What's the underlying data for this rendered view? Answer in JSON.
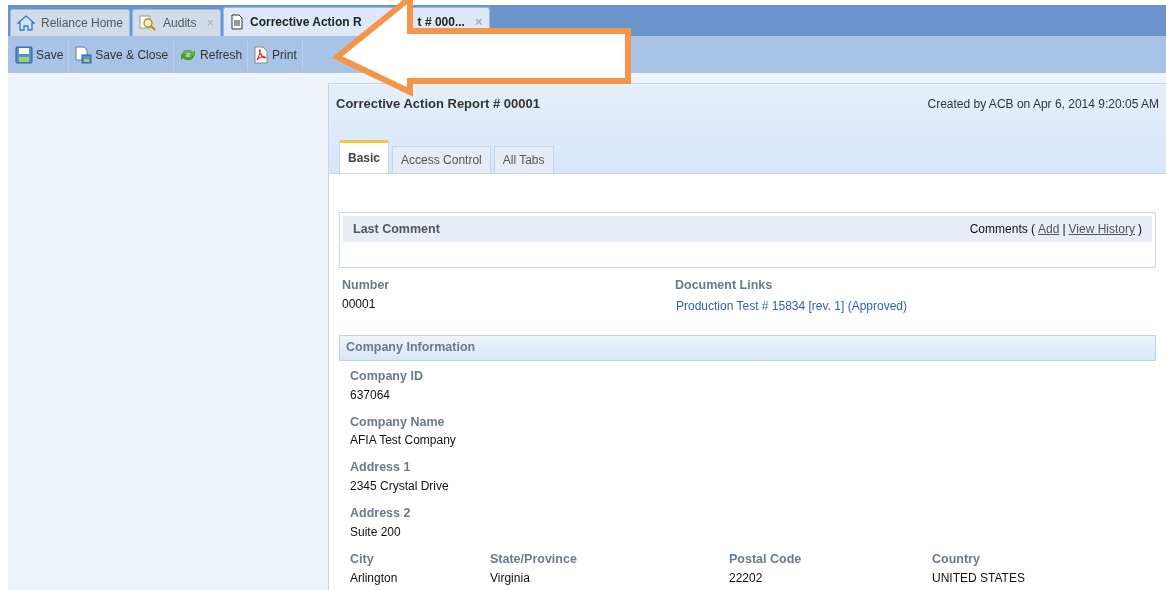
{
  "tabs": [
    {
      "label": "Reliance Home",
      "selected": false
    },
    {
      "label": "Audits",
      "close": "×",
      "selected": false
    },
    {
      "label": "Corrective Action R",
      "label_continued": "t # 000...",
      "close": "×",
      "selected": true
    }
  ],
  "toolbar": [
    {
      "label": "Save"
    },
    {
      "label": "Save & Close"
    },
    {
      "label": "Refresh"
    },
    {
      "label": "Print"
    }
  ],
  "report": {
    "title": "Corrective Action Report # 00001",
    "created": "Created by ACB on Apr 6, 2014 9:20:05 AM",
    "tabs": [
      {
        "label": "Basic",
        "selected": true
      },
      {
        "label": "Access Control",
        "selected": false
      },
      {
        "label": "All Tabs",
        "selected": false
      }
    ],
    "last_comment": {
      "title": "Last Comment",
      "comments_label": "Comments (",
      "add": "Add",
      "separator": "|",
      "view_history": "View History",
      "close": ")"
    },
    "number": {
      "label": "Number",
      "value": "00001"
    },
    "document_links": {
      "label": "Document Links",
      "link": "Production Test # 15834 [rev. 1] (Approved)"
    },
    "company_section": {
      "title": "Company Information",
      "fields": [
        {
          "label": "Company ID",
          "value": "637064"
        },
        {
          "label": "Company Name",
          "value": "AFIA Test Company"
        },
        {
          "label": "Address 1",
          "value": "2345 Crystal Drive"
        },
        {
          "label": "Address 2",
          "value": "Suite 200"
        }
      ],
      "row": [
        {
          "label": "City",
          "value": "Arlington"
        },
        {
          "label": "State/Province",
          "value": "Virginia"
        },
        {
          "label": "Postal Code",
          "value": "22202"
        },
        {
          "label": "Country",
          "value": "UNITED STATES"
        }
      ]
    }
  }
}
